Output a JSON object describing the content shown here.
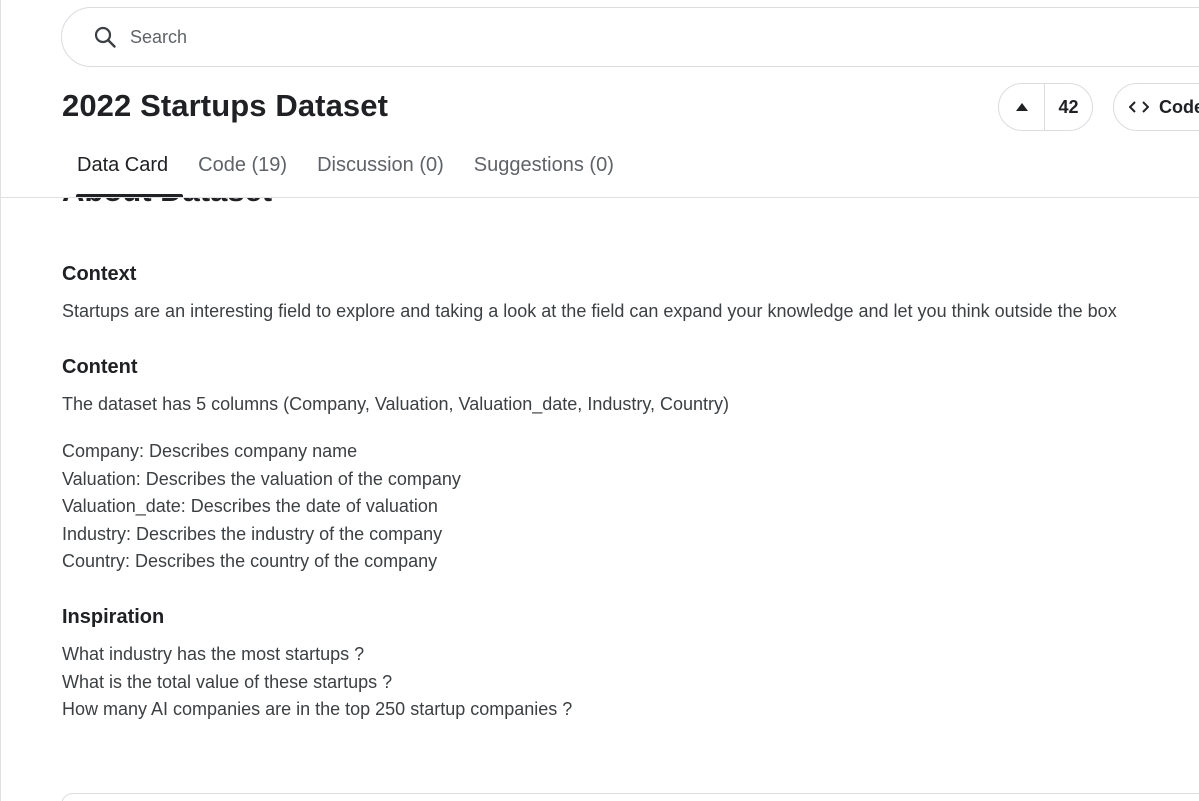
{
  "search": {
    "placeholder": "Search"
  },
  "header": {
    "title": "2022 Startups Dataset",
    "vote_count": "42",
    "code_label": "Code"
  },
  "tabs": [
    {
      "label": "Data Card",
      "active": true
    },
    {
      "label": "Code (19)"
    },
    {
      "label": "Discussion (0)"
    },
    {
      "label": "Suggestions (0)"
    }
  ],
  "content": {
    "about_heading": "About Dataset",
    "context_heading": "Context",
    "context_text": "Startups are an interesting field to explore and taking a look at the field can expand your knowledge and let you think outside the box",
    "content_heading": "Content",
    "content_text": "The dataset has 5 columns (Company, Valuation, Valuation_date, Industry, Country)",
    "columns": [
      "Company: Describes company name",
      "Valuation: Describes the valuation of the company",
      "Valuation_date: Describes the date of valuation",
      "Industry: Describes the industry of the company",
      "Country: Describes the country of the company"
    ],
    "inspiration_heading": "Inspiration",
    "questions": [
      "What industry has the most startups ?",
      "What is the total value of these startups ?",
      "How many AI companies are in the top 250 startup companies ?"
    ]
  }
}
